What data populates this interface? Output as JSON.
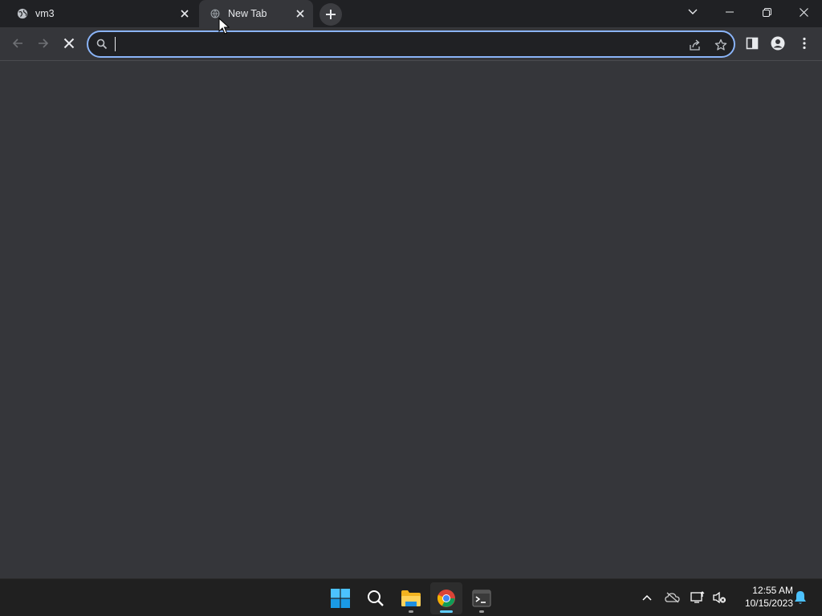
{
  "browser": {
    "tabs": [
      {
        "title": "vm3",
        "active": false,
        "favicon": "globe-icon"
      },
      {
        "title": "New Tab",
        "active": true,
        "favicon": "loading-globe-icon"
      }
    ],
    "omnibox": {
      "value": "",
      "placeholder": ""
    },
    "colors": {
      "tabstrip": "#202124",
      "toolbar": "#35363a",
      "focus_ring": "#8ab4f8"
    }
  },
  "taskbar": {
    "apps": [
      {
        "name": "start",
        "icon": "windows-logo-icon"
      },
      {
        "name": "search",
        "icon": "search-icon"
      },
      {
        "name": "file-explorer",
        "icon": "folder-icon"
      },
      {
        "name": "chrome",
        "icon": "chrome-icon",
        "active": true
      },
      {
        "name": "terminal",
        "icon": "terminal-icon"
      }
    ],
    "clock": {
      "time": "12:55 AM",
      "date": "10/15/2023"
    }
  }
}
